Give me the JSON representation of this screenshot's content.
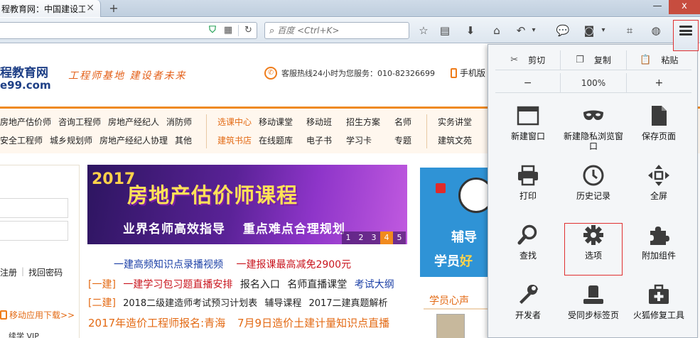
{
  "browser": {
    "tab_title": "程教育网：中国建设工",
    "tab_close": "×",
    "new_tab": "+",
    "win_minimize": "—",
    "win_close": "x",
    "search_placeholder": "百度 <Ctrl+K>"
  },
  "site": {
    "logo_line1": "程教育网",
    "logo_line2": "e99.com",
    "slogan": "工程师基地 建设者未来",
    "hotline": "客服热线24小时为您服务：010-82326699",
    "mobile": "手机版",
    "nav_col1": [
      "房地产估价师",
      "咨询工程师",
      "房地产经纪人",
      "消防师"
    ],
    "nav_col1b": [
      "安全工程师",
      "城乡规划师",
      "房地产经纪人协理",
      "其他"
    ],
    "nav_col2": [
      "选课中心",
      "移动课堂",
      "移动班",
      "招生方案",
      "名师"
    ],
    "nav_col2b": [
      "建筑书店",
      "在线题库",
      "电子书",
      "学习卡",
      "专题"
    ],
    "nav_col3": [
      "实务讲堂"
    ],
    "nav_col3b": [
      "建筑文苑"
    ],
    "register": "注册",
    "find_password": "找回密码",
    "mobile_download": "移动应用下载>>",
    "small_row": "续学 VIP",
    "banner_year": "2017",
    "banner_title": "房地产估价师课程",
    "banner_sub1": "业界名师高效指导",
    "banner_sub2": "重点难点合理规划",
    "banner_dots": [
      "1",
      "2",
      "3",
      "4",
      "5"
    ],
    "news1_a": "一建高频知识点录播视频",
    "news1_b": "一建报课最高减免2900元",
    "news2_tag": "[一建]",
    "news2_a": "一建学习包习题直播安排",
    "news2_b": "报名入口",
    "news2_c": "名师直播课堂",
    "news2_d": "考试大纲",
    "news3_tag": "[二建]",
    "news3_a": "2018二级建造师考试预习计划表",
    "news3_b": "辅导课程",
    "news3_c": "2017二建真题解析",
    "news4_a": "2017年造价工程师报名:青海",
    "news4_b": "7月9日造价土建计量知识点直播",
    "side_text1": "辅导",
    "side_text2a": "学员",
    "side_text2b": "好",
    "student_title": "学员心声"
  },
  "menu": {
    "cut": "剪切",
    "copy": "复制",
    "paste": "粘贴",
    "zoom_out": "−",
    "zoom": "100%",
    "zoom_in": "+",
    "items": [
      {
        "label": "新建窗口",
        "icon": "window-icon"
      },
      {
        "label": "新建隐私浏览窗口",
        "icon": "mask-icon"
      },
      {
        "label": "保存页面",
        "icon": "page-icon"
      },
      {
        "label": "打印",
        "icon": "printer-icon"
      },
      {
        "label": "历史记录",
        "icon": "clock-icon"
      },
      {
        "label": "全屏",
        "icon": "fullscreen-icon"
      },
      {
        "label": "查找",
        "icon": "magnifier-icon"
      },
      {
        "label": "选项",
        "icon": "gear-icon"
      },
      {
        "label": "附加组件",
        "icon": "puzzle-icon"
      },
      {
        "label": "开发者",
        "icon": "wrench-icon"
      },
      {
        "label": "受同步标签页",
        "icon": "sync-icon"
      },
      {
        "label": "火狐修复工具",
        "icon": "medkit-icon"
      }
    ]
  },
  "colors": {
    "accent_orange": "#e36a14",
    "highlight_red": "#e03030",
    "link_blue": "#1b3fa6"
  }
}
